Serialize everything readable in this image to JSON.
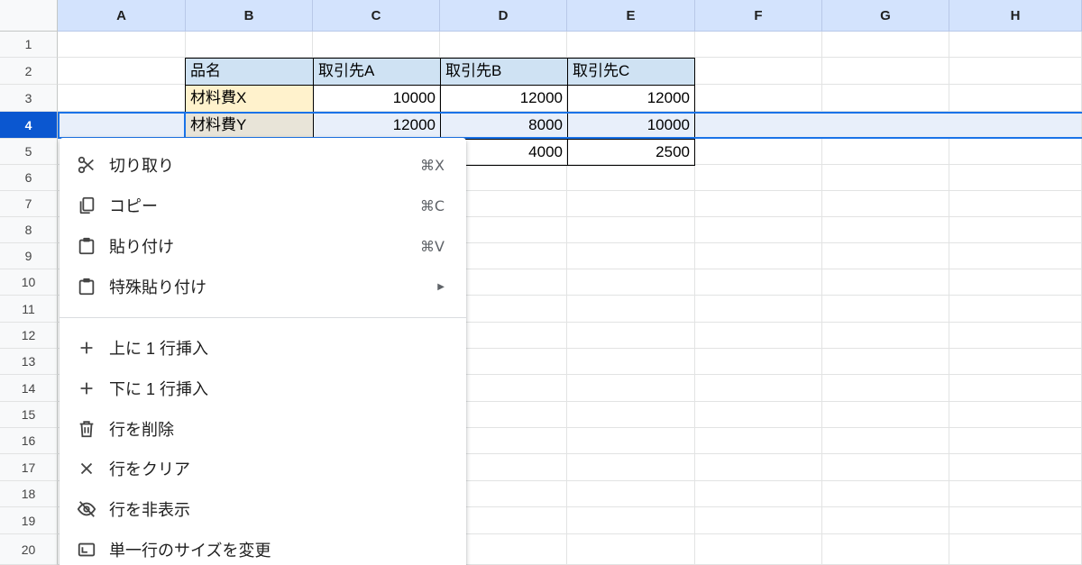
{
  "columns": [
    "A",
    "B",
    "C",
    "D",
    "E",
    "F",
    "G",
    "H"
  ],
  "rows": [
    "1",
    "2",
    "3",
    "4",
    "5",
    "6",
    "7",
    "8",
    "9",
    "10",
    "11",
    "12",
    "13",
    "14",
    "15",
    "16",
    "17",
    "18",
    "19",
    "20"
  ],
  "table": {
    "header": [
      "品名",
      "取引先A",
      "取引先B",
      "取引先C"
    ],
    "row3": [
      "材料費X",
      "10000",
      "12000",
      "12000"
    ],
    "row4": [
      "材料費Y",
      "12000",
      "8000",
      "10000"
    ],
    "row5": [
      "",
      "",
      "4000",
      "2500"
    ]
  },
  "selected_row": "4",
  "colors": {
    "header_fill": "#cfe2f3",
    "item_x_fill": "#fff2cc",
    "item_y_fill": "#e8e4d8",
    "selection": "#1a73e8"
  },
  "context_menu": {
    "items": [
      {
        "label": "切り取り",
        "shortcut": "⌘X",
        "icon": "scissors-icon"
      },
      {
        "label": "コピー",
        "shortcut": "⌘C",
        "icon": "copy-icon"
      },
      {
        "label": "貼り付け",
        "shortcut": "⌘V",
        "icon": "clipboard-icon"
      },
      {
        "label": "特殊貼り付け",
        "arrow": "▶",
        "icon": "clipboard-icon"
      },
      {
        "label": "上に 1 行挿入",
        "icon": "plus-icon"
      },
      {
        "label": "下に 1 行挿入",
        "icon": "plus-icon"
      },
      {
        "label": "行を削除",
        "icon": "trash-icon"
      },
      {
        "label": "行をクリア",
        "icon": "close-icon"
      },
      {
        "label": "行を非表示",
        "icon": "eye-off-icon"
      },
      {
        "label": "単一行のサイズを変更",
        "icon": "resize-icon"
      }
    ]
  }
}
